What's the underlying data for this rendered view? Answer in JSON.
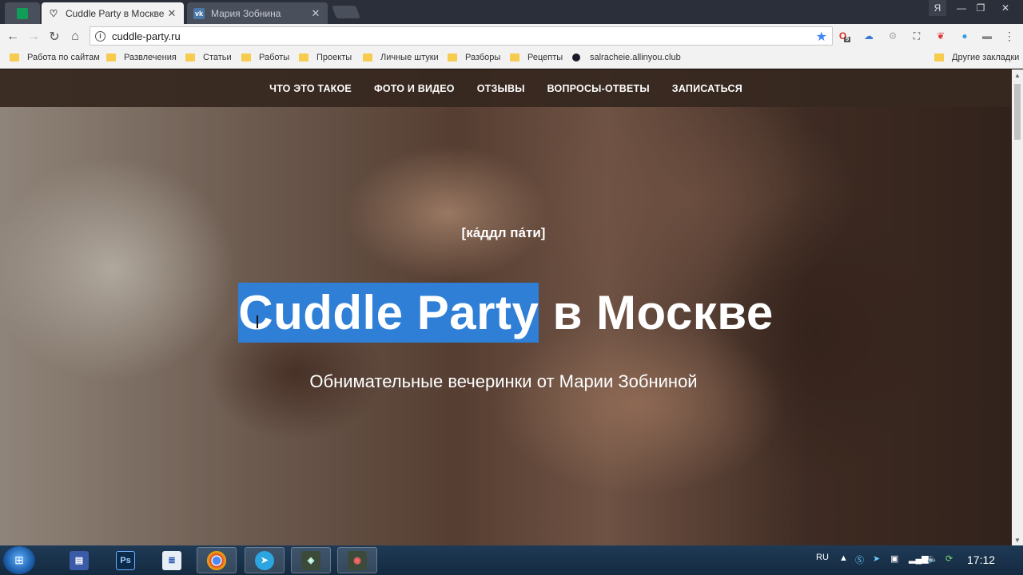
{
  "browser": {
    "tabs": [
      {
        "title": "Cuddle Party в Москве",
        "active": true
      },
      {
        "title": "Мария Зобнина",
        "active": false
      }
    ],
    "window_user": "Я",
    "address": "cuddle-party.ru",
    "extension_badge": "9",
    "bookmarks": [
      "Работа по сайтам",
      "Развлечения",
      "Статьи",
      "Работы",
      "Проекты",
      "Личные штуки",
      "Разборы",
      "Рецепты",
      "salracheie.allinyou.club"
    ],
    "other_bookmarks": "Другие закладки"
  },
  "site": {
    "nav": [
      "ЧТО ЭТО ТАКОЕ",
      "ФОТО И ВИДЕО",
      "ОТЗЫВЫ",
      "ВОПРОСЫ-ОТВЕТЫ",
      "ЗАПИСАТЬСЯ"
    ],
    "pronunciation": "[ка́ддл па́ти]",
    "headline_selected": "Cuddle Party",
    "headline_rest": " в Москве",
    "subtitle": "Обнимательные вечеринки от Марии Зобниной"
  },
  "taskbar": {
    "language": "RU",
    "time": "17:12"
  },
  "colors": {
    "selection": "#2f7fd6",
    "navbar": "#372820",
    "tabstrip": "#2b2f3a"
  }
}
